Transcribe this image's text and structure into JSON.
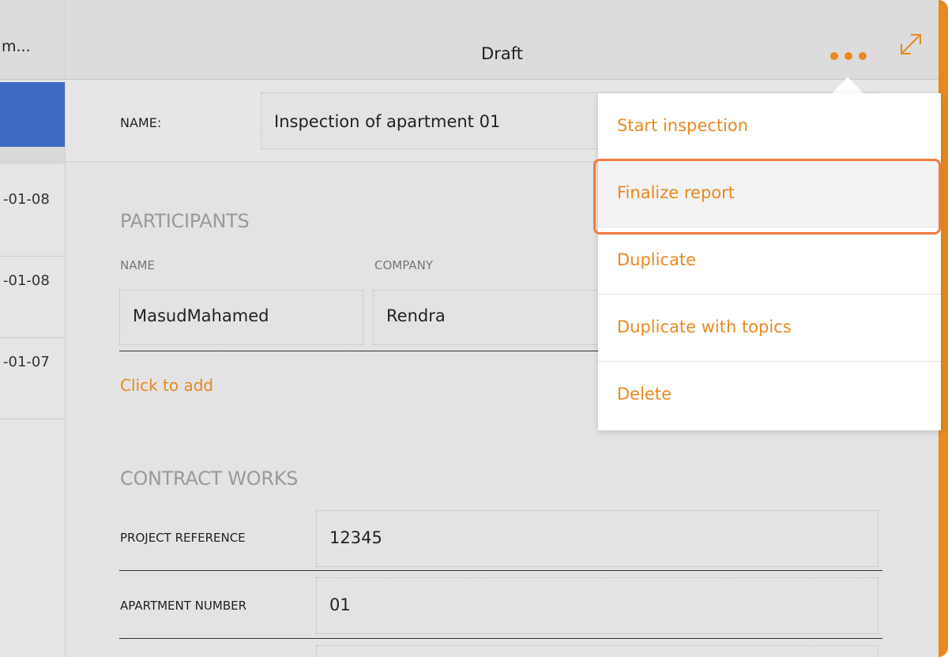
{
  "list_pane": {
    "header_title": "m...",
    "rows": [
      {
        "date": "-01-08"
      },
      {
        "date": "-01-08"
      },
      {
        "date": "-01-07"
      }
    ]
  },
  "header": {
    "title": "Draft",
    "more_icon": "more-horizontal-icon",
    "expand_icon": "expand-icon"
  },
  "form": {
    "name_label": "NAME:",
    "name_value": "Inspection of apartment 01",
    "participants": {
      "title": "PARTICIPANTS",
      "col_name": "NAME",
      "col_company": "COMPANY",
      "rows": [
        {
          "name": "MasudMahamed",
          "company": "Rendra"
        }
      ],
      "add_link": "Click to add"
    },
    "contract_works": {
      "title": "CONTRACT WORKS",
      "fields": [
        {
          "label": "PROJECT REFERENCE",
          "value": "12345"
        },
        {
          "label": "APARTMENT NUMBER",
          "value": "01"
        }
      ]
    }
  },
  "menu": {
    "items": [
      {
        "label": "Start inspection"
      },
      {
        "label": "Finalize report"
      },
      {
        "label": "Duplicate"
      },
      {
        "label": "Duplicate with topics"
      },
      {
        "label": "Delete"
      }
    ],
    "highlighted_index": 1
  },
  "colors": {
    "accent": "#e8891f",
    "selection": "#3d6bc4",
    "focus_ring": "#f07a40"
  }
}
